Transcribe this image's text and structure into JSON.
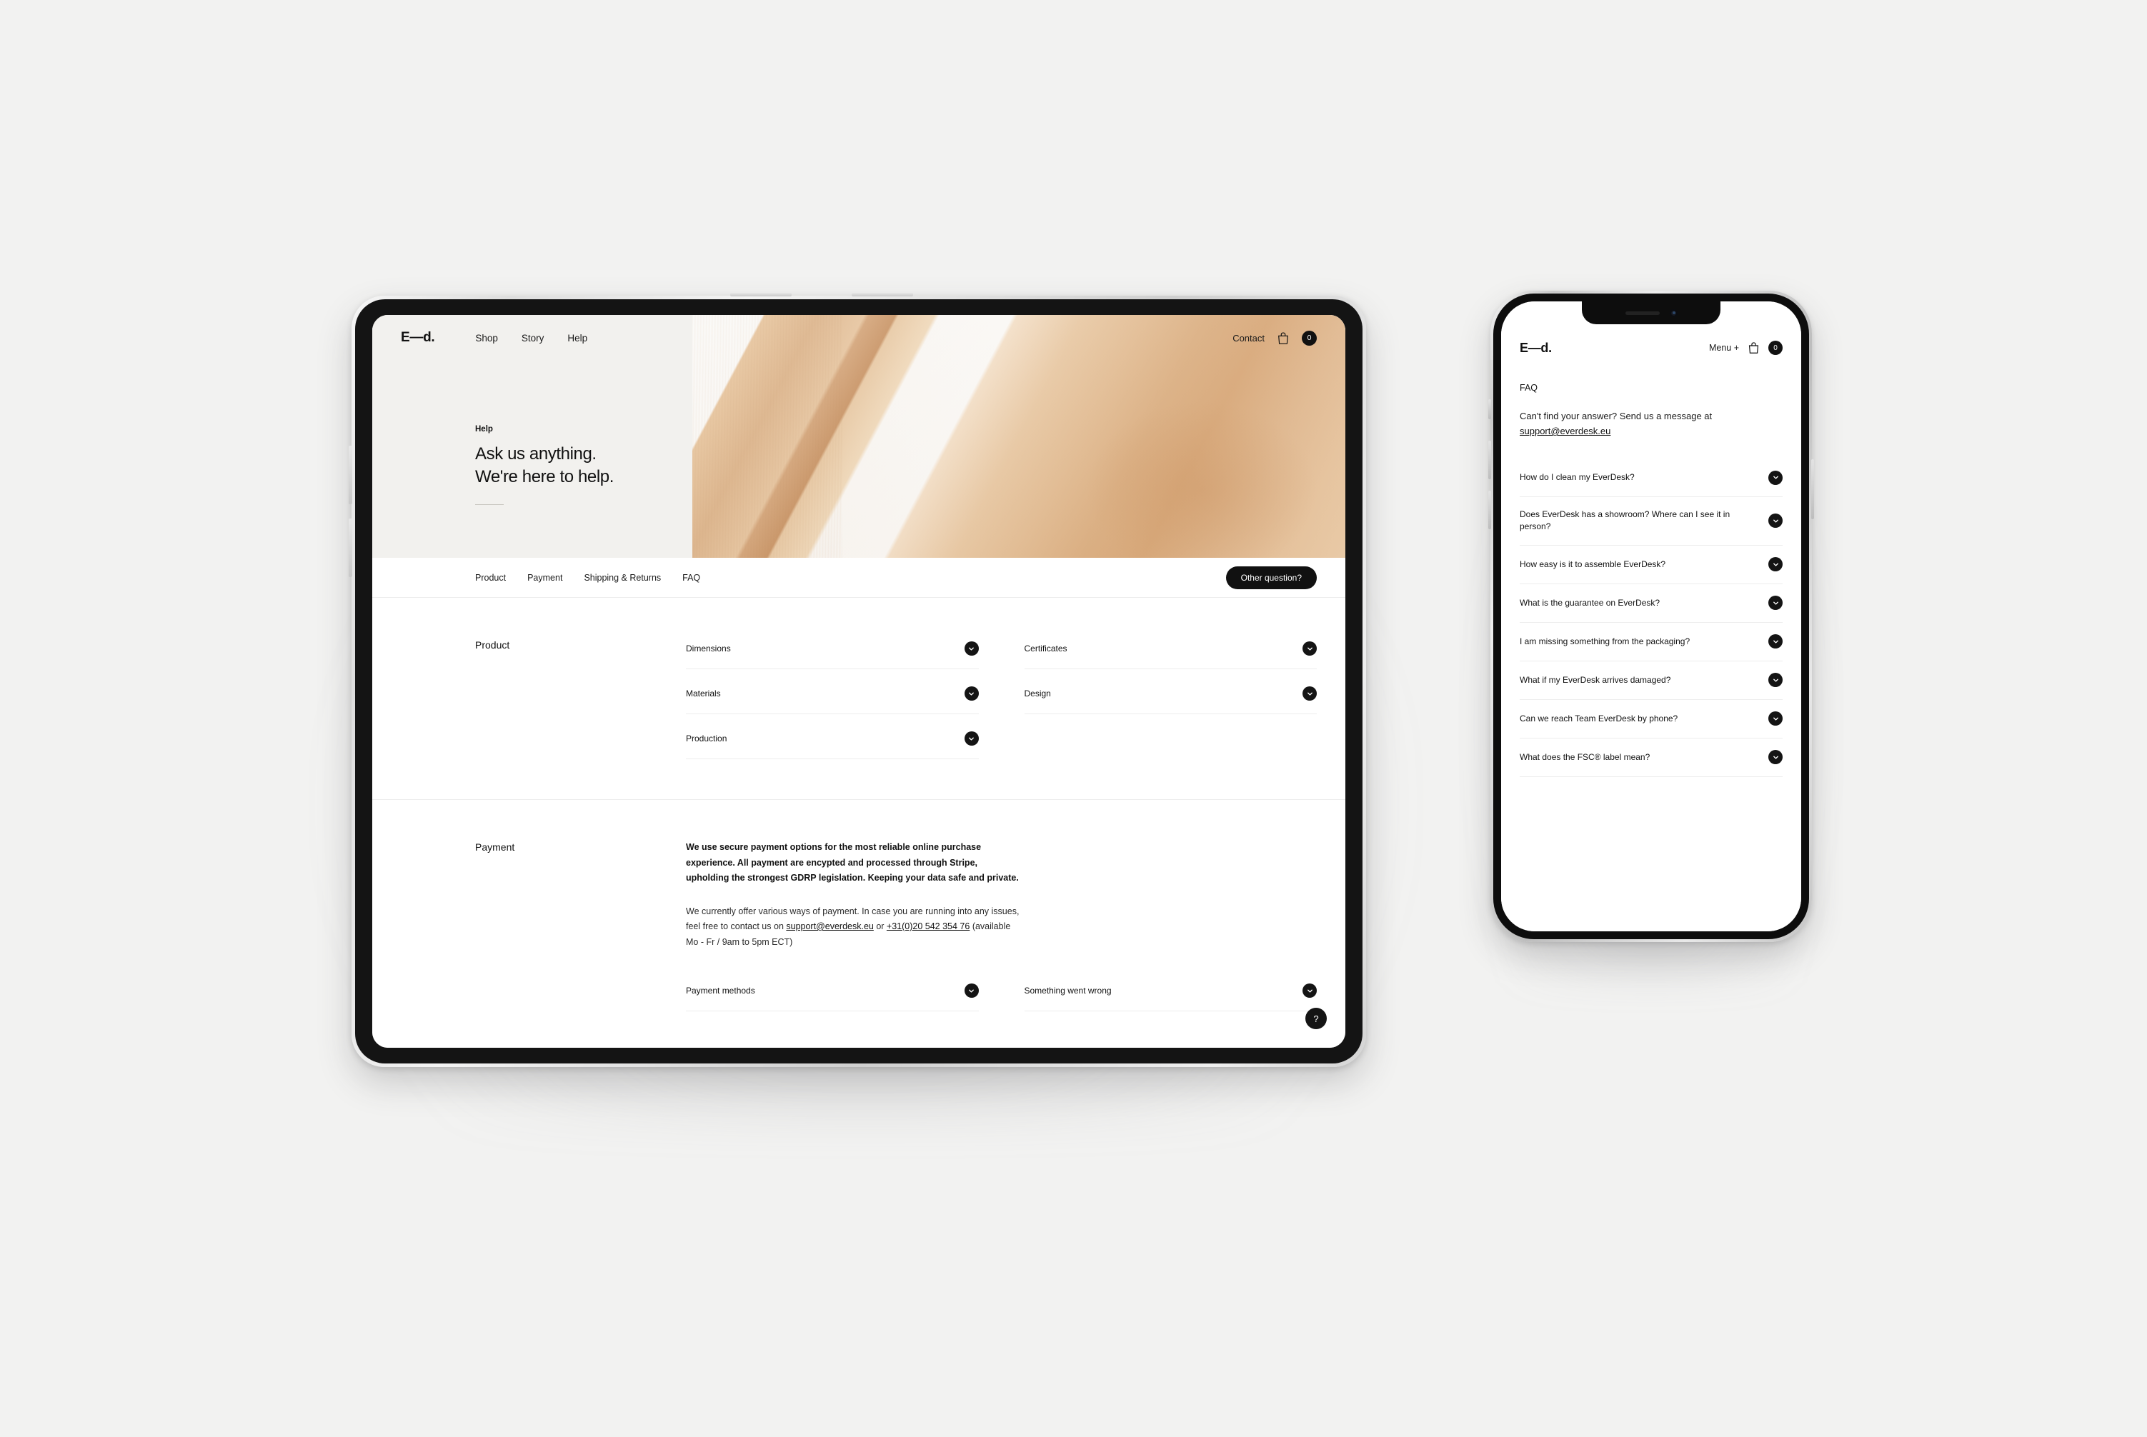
{
  "brand": {
    "logo": "E—d."
  },
  "tablet": {
    "nav": {
      "links": [
        {
          "label": "Shop"
        },
        {
          "label": "Story"
        },
        {
          "label": "Help"
        }
      ],
      "contact_label": "Contact",
      "cart_count": "0",
      "bag_icon": "shopping-bag-icon"
    },
    "hero": {
      "eyebrow": "Help",
      "title": "Ask us anything.\nWe're here to help."
    },
    "tabs": [
      {
        "label": "Product"
      },
      {
        "label": "Payment"
      },
      {
        "label": "Shipping & Returns"
      },
      {
        "label": "FAQ"
      }
    ],
    "other_question_label": "Other question?",
    "sections": [
      {
        "title": "Product",
        "accordion_left": [
          {
            "label": "Dimensions"
          },
          {
            "label": "Materials"
          },
          {
            "label": "Production"
          }
        ],
        "accordion_right": [
          {
            "label": "Certificates"
          },
          {
            "label": "Design"
          }
        ]
      },
      {
        "title": "Payment",
        "paragraph_1": "We use secure payment options for the most reliable online purchase experience. All payment are encypted and processed through Stripe, upholding the strongest GDRP legislation. Keeping your data safe and private.",
        "paragraph_2_a": "We currently offer various ways of payment. In case you are running into any issues, feel free to contact us on ",
        "email": "support@everdesk.eu",
        "paragraph_2_b": " or ",
        "phone": "+31(0)20 542 354 76",
        "paragraph_2_c": " (available Mo - Fr / 9am to 5pm ECT)",
        "accordion_left": [
          {
            "label": "Payment methods"
          }
        ],
        "accordion_right": [
          {
            "label": "Something went wrong"
          }
        ]
      }
    ],
    "fab_label": "?"
  },
  "phone": {
    "nav": {
      "menu_label": "Menu +",
      "cart_count": "0",
      "bag_icon": "shopping-bag-icon"
    },
    "section_title": "FAQ",
    "intro_a": "Can't find your answer? Send us a message at ",
    "intro_email": "support@everdesk.eu",
    "faq": [
      {
        "question": "How do I clean my EverDesk?"
      },
      {
        "question": "Does EverDesk has a showroom? Where can I see it in person?"
      },
      {
        "question": "How easy is it to assemble EverDesk?"
      },
      {
        "question": "What is the guarantee on EverDesk?"
      },
      {
        "question": "I am missing something from the packaging?"
      },
      {
        "question": "What if my EverDesk arrives damaged?"
      },
      {
        "question": "Can we reach Team EverDesk by phone?"
      },
      {
        "question": "What does the FSC® label mean?"
      }
    ]
  },
  "colors": {
    "background": "#f2f2f1",
    "accent": "#111111",
    "hero_bg": "#f2f1ee",
    "rule": "#ececec"
  }
}
